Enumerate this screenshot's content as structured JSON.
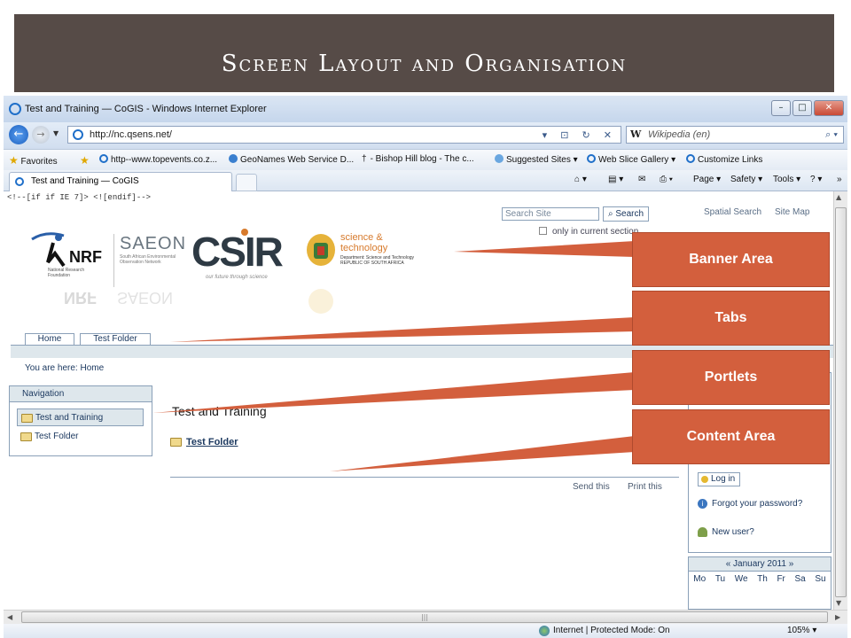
{
  "slide": {
    "title": "Screen Layout and Organisation"
  },
  "browser": {
    "window_title": "Test and Training — CoGIS - Windows Internet Explorer",
    "address": "http://nc.qsens.net/",
    "search_placeholder": "Wikipedia (en)",
    "search_provider_icon": "W",
    "window_buttons": {
      "minimize": "–",
      "maximize": "□",
      "close": "✕"
    },
    "favorites": {
      "label": "Favorites",
      "items": [
        "http--www.topevents.co.z...",
        "GeoNames Web Service D...",
        "- Bishop Hill blog - The c...",
        "Suggested Sites ▾",
        "Web Slice Gallery ▾",
        "Customize Links"
      ]
    },
    "tab": "Test and Training — CoGIS",
    "commands": {
      "page": "Page ▾",
      "safety": "Safety ▾",
      "tools": "Tools ▾",
      "help": "? ▾",
      "more": "»"
    },
    "status": {
      "zone": "Internet | Protected Mode: On",
      "zoom": "105% ▾"
    }
  },
  "page": {
    "conditional_comment": "<!--[if if IE 7]> <![endif]-->",
    "search": {
      "placeholder": "Search Site",
      "button": "Search",
      "only_current": "only in current section"
    },
    "top_links": [
      "Spatial Search",
      "Site Map"
    ],
    "logos": {
      "nrf": "NRF",
      "nrf_sub": "National Research Foundation",
      "saeon": "SAEON",
      "saeon_sub": "South African Environmental Observation Network",
      "csir": "CSIR",
      "csir_tag": "our future through science",
      "dst": "science & technology",
      "dst_sub": "Department: Science and Technology REPUBLIC OF SOUTH AFRICA"
    },
    "tabs": [
      "Home",
      "Test Folder"
    ],
    "breadcrumb": {
      "prefix": "You are here:",
      "current": "Home"
    },
    "navigation": {
      "title": "Navigation",
      "items": [
        "Test and Training",
        "Test Folder"
      ]
    },
    "content": {
      "title": "Test and Training",
      "link": "Test Folder",
      "actions": [
        "Send this",
        "Print this"
      ]
    },
    "login": {
      "button": "Log in",
      "forgot": "Forgot your password?",
      "new_user": "New user?"
    },
    "calendar": {
      "month": "« January 2011 »",
      "days": [
        "Mo",
        "Tu",
        "We",
        "Th",
        "Fr",
        "Sa",
        "Su"
      ]
    }
  },
  "callouts": [
    "Banner Area",
    "Tabs",
    "Portlets",
    "Content Area"
  ],
  "colors": {
    "title_bar": "#564b47",
    "callout": "#d35f3d",
    "plone_border": "#8aa0b8",
    "plone_band": "#dee7ec"
  }
}
